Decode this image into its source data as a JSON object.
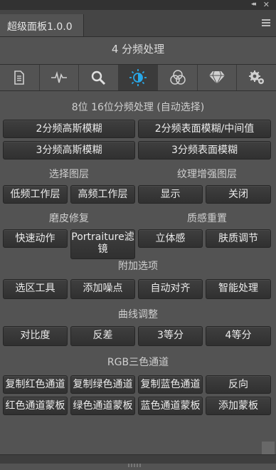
{
  "window": {
    "collapse_icon": "double-chevron-icon",
    "close_icon": "close-icon"
  },
  "tab": {
    "label": "超级面板1.0.0"
  },
  "panel": {
    "title": "4 分频处理"
  },
  "toolbar": {
    "icons": [
      "document-icon",
      "waveform-icon",
      "search-icon",
      "brightness-icon",
      "channels-icon",
      "diamond-icon",
      "gear-icon"
    ],
    "active_index": 3,
    "active_color": "#29a8e8"
  },
  "sections": {
    "split": {
      "heading": "8位 16位分频处理 (自动选择)",
      "buttons": [
        "2分频高斯模糊",
        "2分频表面模糊/中间值",
        "3分频高斯模糊",
        "3分频表面模糊"
      ]
    },
    "layers": {
      "heading_left": "选择图层",
      "heading_right": "纹理增强图层",
      "buttons": [
        "低频工作层",
        "高频工作层",
        "显示",
        "关闭"
      ]
    },
    "skin": {
      "heading_left": "磨皮修复",
      "heading_right": "质感重置",
      "buttons": [
        "快速动作",
        "Portraiture滤镜",
        "立体感",
        "肤质调节"
      ]
    },
    "extra": {
      "heading": "附加选项",
      "buttons": [
        "选区工具",
        "添加噪点",
        "自动对齐",
        "智能处理"
      ]
    },
    "curves": {
      "heading": "曲线调整",
      "buttons": [
        "对比度",
        "反差",
        "3等分",
        "4等分"
      ]
    },
    "rgb": {
      "heading": "RGB三色通道",
      "buttons": [
        "复制红色通道",
        "复制绿色通道",
        "复制蓝色通道",
        "反向",
        "红色通道蒙板",
        "绿色通道蒙板",
        "蓝色通道蒙板",
        "添加蒙板"
      ]
    }
  }
}
